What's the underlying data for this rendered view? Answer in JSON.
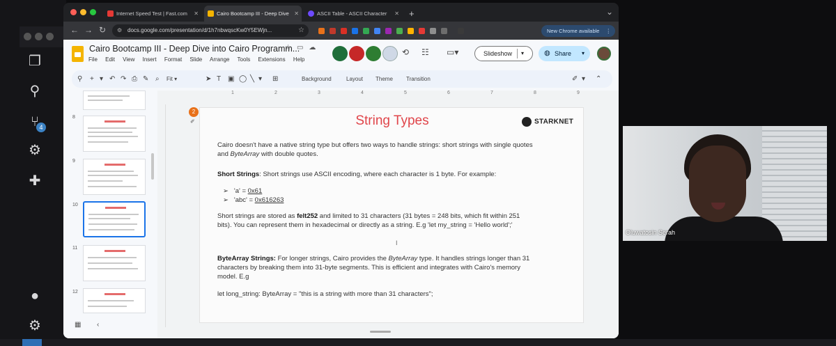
{
  "chrome": {
    "tabs": [
      {
        "label": "Internet Speed Test | Fast.com",
        "favicon_color": "#e53935"
      },
      {
        "label": "Cairo Bootcamp III - Deep Dive",
        "favicon_color": "#f4b400"
      },
      {
        "label": "ASCII Table - ASCII Character",
        "favicon_color": "#6d4aff"
      }
    ],
    "new_tab": "+",
    "url": "docs.google.com/presentation/d/1h7nbwqscKw0Y5EWjn...",
    "new_chrome_available": "New Chrome available"
  },
  "docs": {
    "title": "Cairo Bootcamp III - Deep Dive into Cairo Programm...",
    "menu": [
      "File",
      "Edit",
      "View",
      "Insert",
      "Format",
      "Slide",
      "Arrange",
      "Tools",
      "Extensions",
      "Help"
    ],
    "slideshow_label": "Slideshow",
    "share_label": "Share",
    "toolbar": {
      "zoom": "Fit",
      "background": "Background",
      "layout": "Layout",
      "theme": "Theme",
      "transition": "Transition"
    },
    "slide_numbers": [
      "8",
      "9",
      "10",
      "11",
      "12"
    ],
    "ruler_numbers": [
      "1",
      "2",
      "3",
      "4",
      "5",
      "6",
      "7",
      "8",
      "9"
    ]
  },
  "slide": {
    "title": "String Types",
    "brand": "STARKNET",
    "intro_1": "Cairo doesn't have a native string type but offers two ways to handle strings: short strings with single quotes",
    "intro_2a": "and ",
    "intro_2b": "ByteArray",
    "intro_2c": " with double quotes.",
    "short_head": "Short Strings",
    "short_text": ": Short strings use ASCII encoding, where each character is 1 byte. For example:",
    "bullet_1_pre": "'a' = ",
    "bullet_1_val": "0x61",
    "bullet_2_pre": "'abc' = ",
    "bullet_2_val": "0x616263",
    "stored_1a": "Short strings are stored as ",
    "stored_1b": "felt252",
    "stored_1c": " and limited to 31 characters (31 bytes = 248 bits, which fit within 251",
    "stored_2": "bits). You can represent them in hexadecimal or directly as a string. E.g 'let my_string = 'Hello world';'",
    "bytearray_head": "ByteArray Strings:",
    "bytearray_1a": " For longer strings, Cairo provides the ",
    "bytearray_1b": "ByteArray",
    "bytearray_1c": " type. It handles strings longer than 31",
    "bytearray_2": "characters by breaking them into 31-byte segments. This is efficient and integrates with Cairo's memory",
    "bytearray_3": "model. E.g",
    "code_line": "let long_string: ByteArray = \"this is a string with more than 31 characters\";"
  },
  "vscode": {
    "badge_count": "4"
  },
  "webcam": {
    "name": "Oluwatosin Serah"
  }
}
